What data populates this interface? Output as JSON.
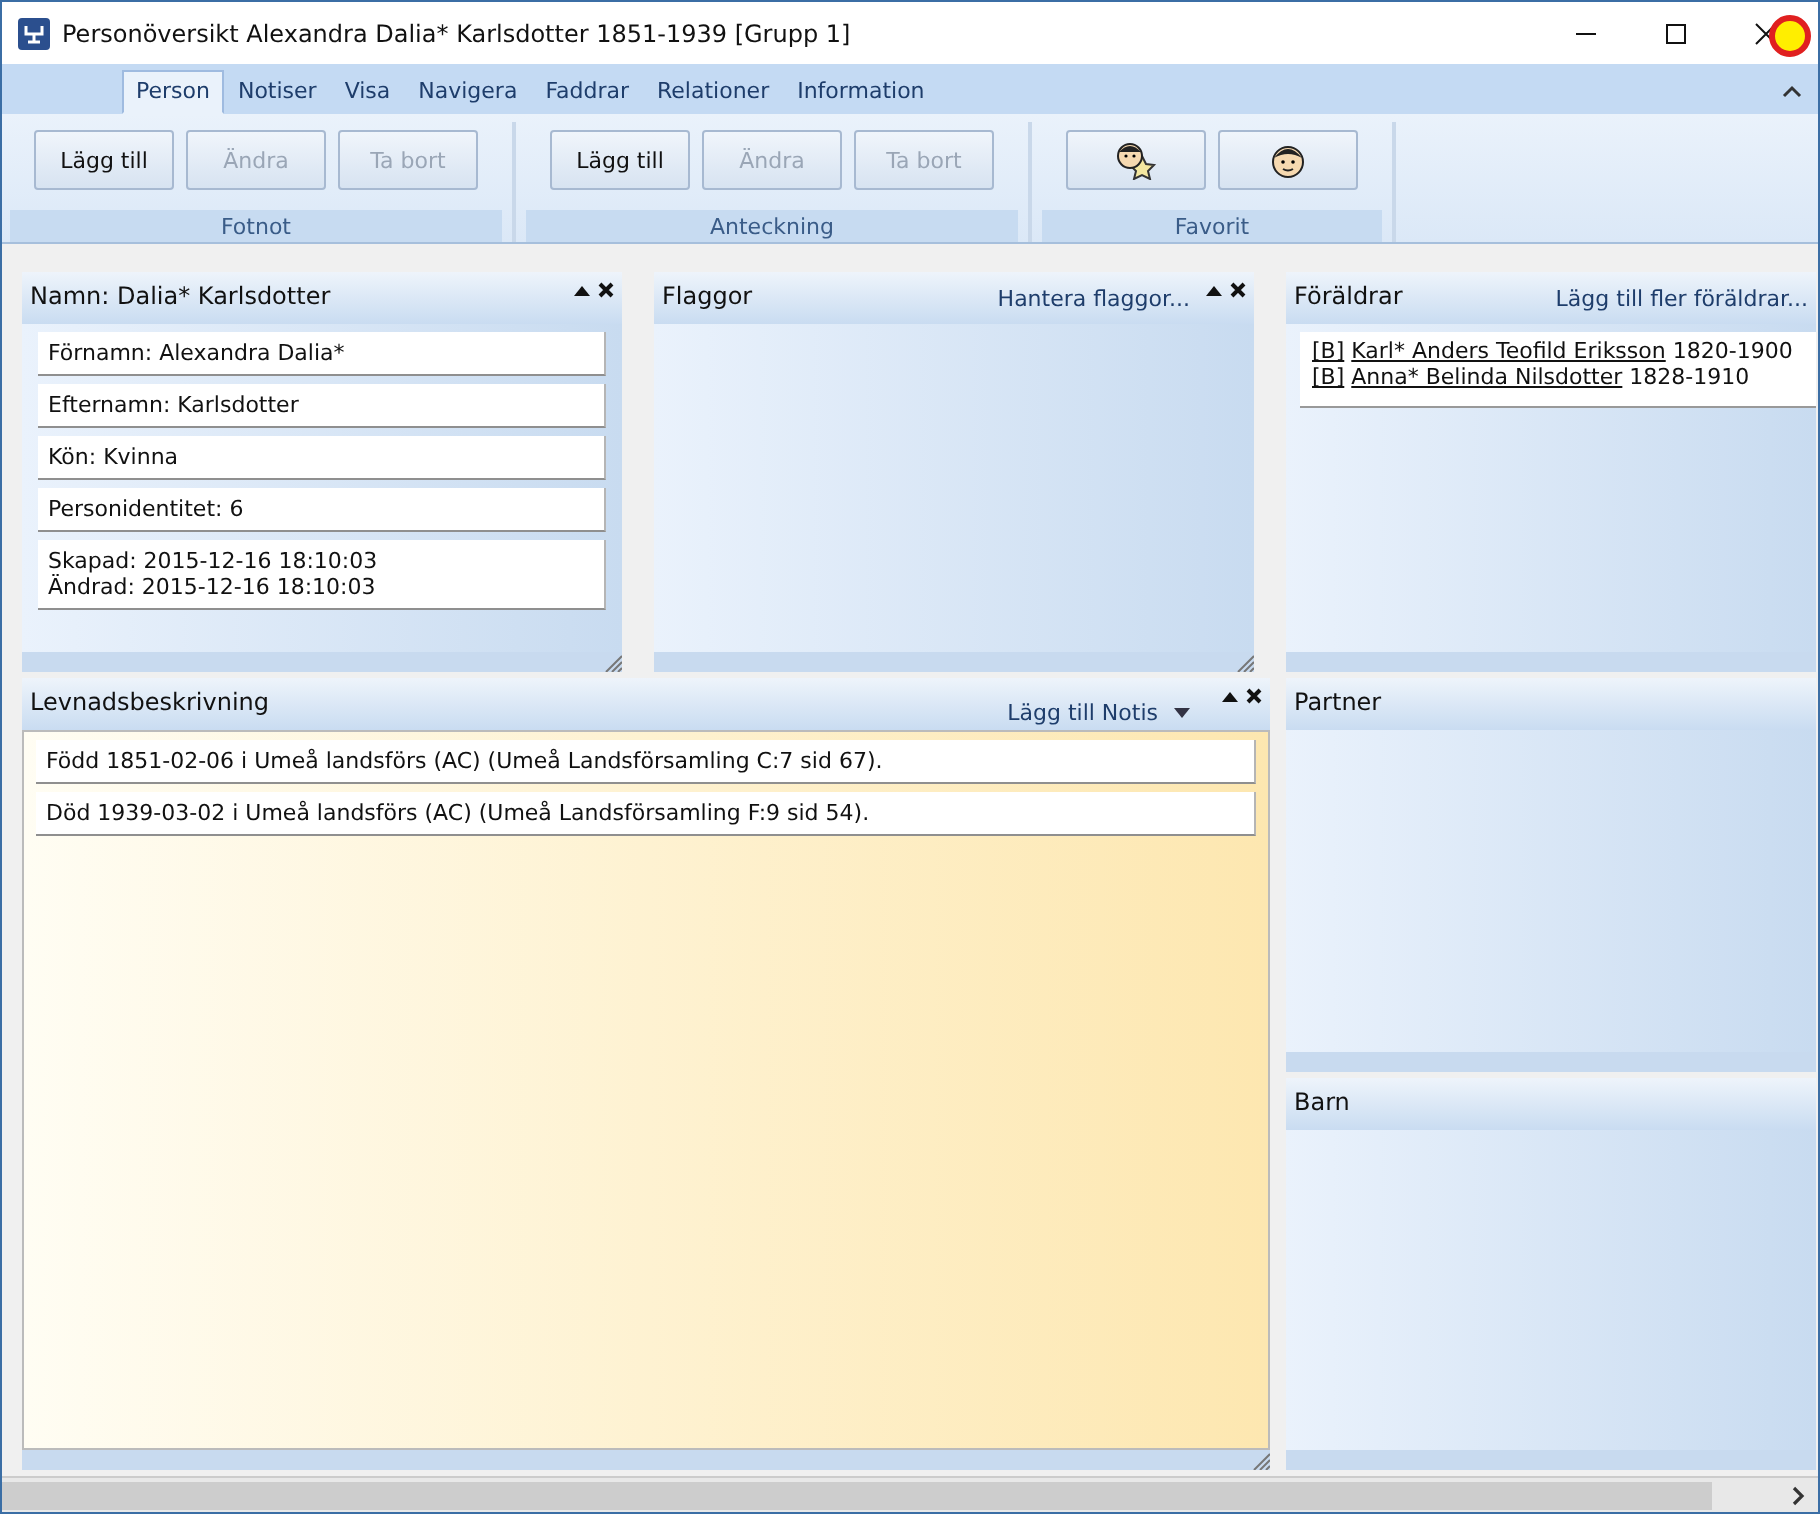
{
  "window": {
    "title": "Personöversikt Alexandra Dalia* Karlsdotter 1851-1939 [Grupp 1]"
  },
  "tabs": [
    {
      "label": "Person",
      "selected": true
    },
    {
      "label": "Notiser",
      "selected": false
    },
    {
      "label": "Visa",
      "selected": false
    },
    {
      "label": "Navigera",
      "selected": false
    },
    {
      "label": "Faddrar",
      "selected": false
    },
    {
      "label": "Relationer",
      "selected": false
    },
    {
      "label": "Information",
      "selected": false
    }
  ],
  "ribbon_groups": [
    {
      "label": "Fotnot",
      "buttons": [
        {
          "kind": "text",
          "label": "Lägg till",
          "disabled": false
        },
        {
          "kind": "text",
          "label": "Ändra",
          "disabled": true
        },
        {
          "kind": "text",
          "label": "Ta bort",
          "disabled": true
        }
      ]
    },
    {
      "label": "Anteckning",
      "buttons": [
        {
          "kind": "text",
          "label": "Lägg till",
          "disabled": false
        },
        {
          "kind": "text",
          "label": "Ändra",
          "disabled": true
        },
        {
          "kind": "text",
          "label": "Ta bort",
          "disabled": true
        }
      ]
    },
    {
      "label": "Favorit",
      "buttons": [
        {
          "kind": "face-star",
          "disabled": false
        },
        {
          "kind": "face",
          "disabled": false
        }
      ]
    }
  ],
  "name_panel": {
    "title": "Namn: Dalia* Karlsdotter",
    "fields": [
      [
        "Förnamn: Alexandra Dalia*"
      ],
      [
        "Efternamn: Karlsdotter"
      ],
      [
        "Kön: Kvinna"
      ],
      [
        "Personidentitet: 6"
      ],
      [
        "Skapad: 2015-12-16 18:10:03",
        "Ändrad: 2015-12-16 18:10:03"
      ]
    ]
  },
  "flags_panel": {
    "title": "Flaggor",
    "action": "Hantera flaggor..."
  },
  "parents_panel": {
    "title": "Föräldrar",
    "action": "Lägg till fler föräldrar...",
    "parents": [
      {
        "tag": "[B]",
        "name": "Karl* Anders Teofild Eriksson",
        "years": "1820-1900"
      },
      {
        "tag": "[B]",
        "name": "Anna* Belinda Nilsdotter",
        "years": "1828-1910"
      }
    ]
  },
  "life_panel": {
    "title": "Levnadsbeskrivning",
    "action": "Lägg till Notis",
    "entries": [
      "Född 1851-02-06 i Umeå landsförs (AC) (Umeå Landsförsamling C:7 sid  67).",
      "Död 1939-03-02 i Umeå landsförs (AC) (Umeå Landsförsamling F:9 sid  54)."
    ]
  },
  "partner_panel": {
    "title": "Partner"
  },
  "children_panel": {
    "title": "Barn"
  }
}
